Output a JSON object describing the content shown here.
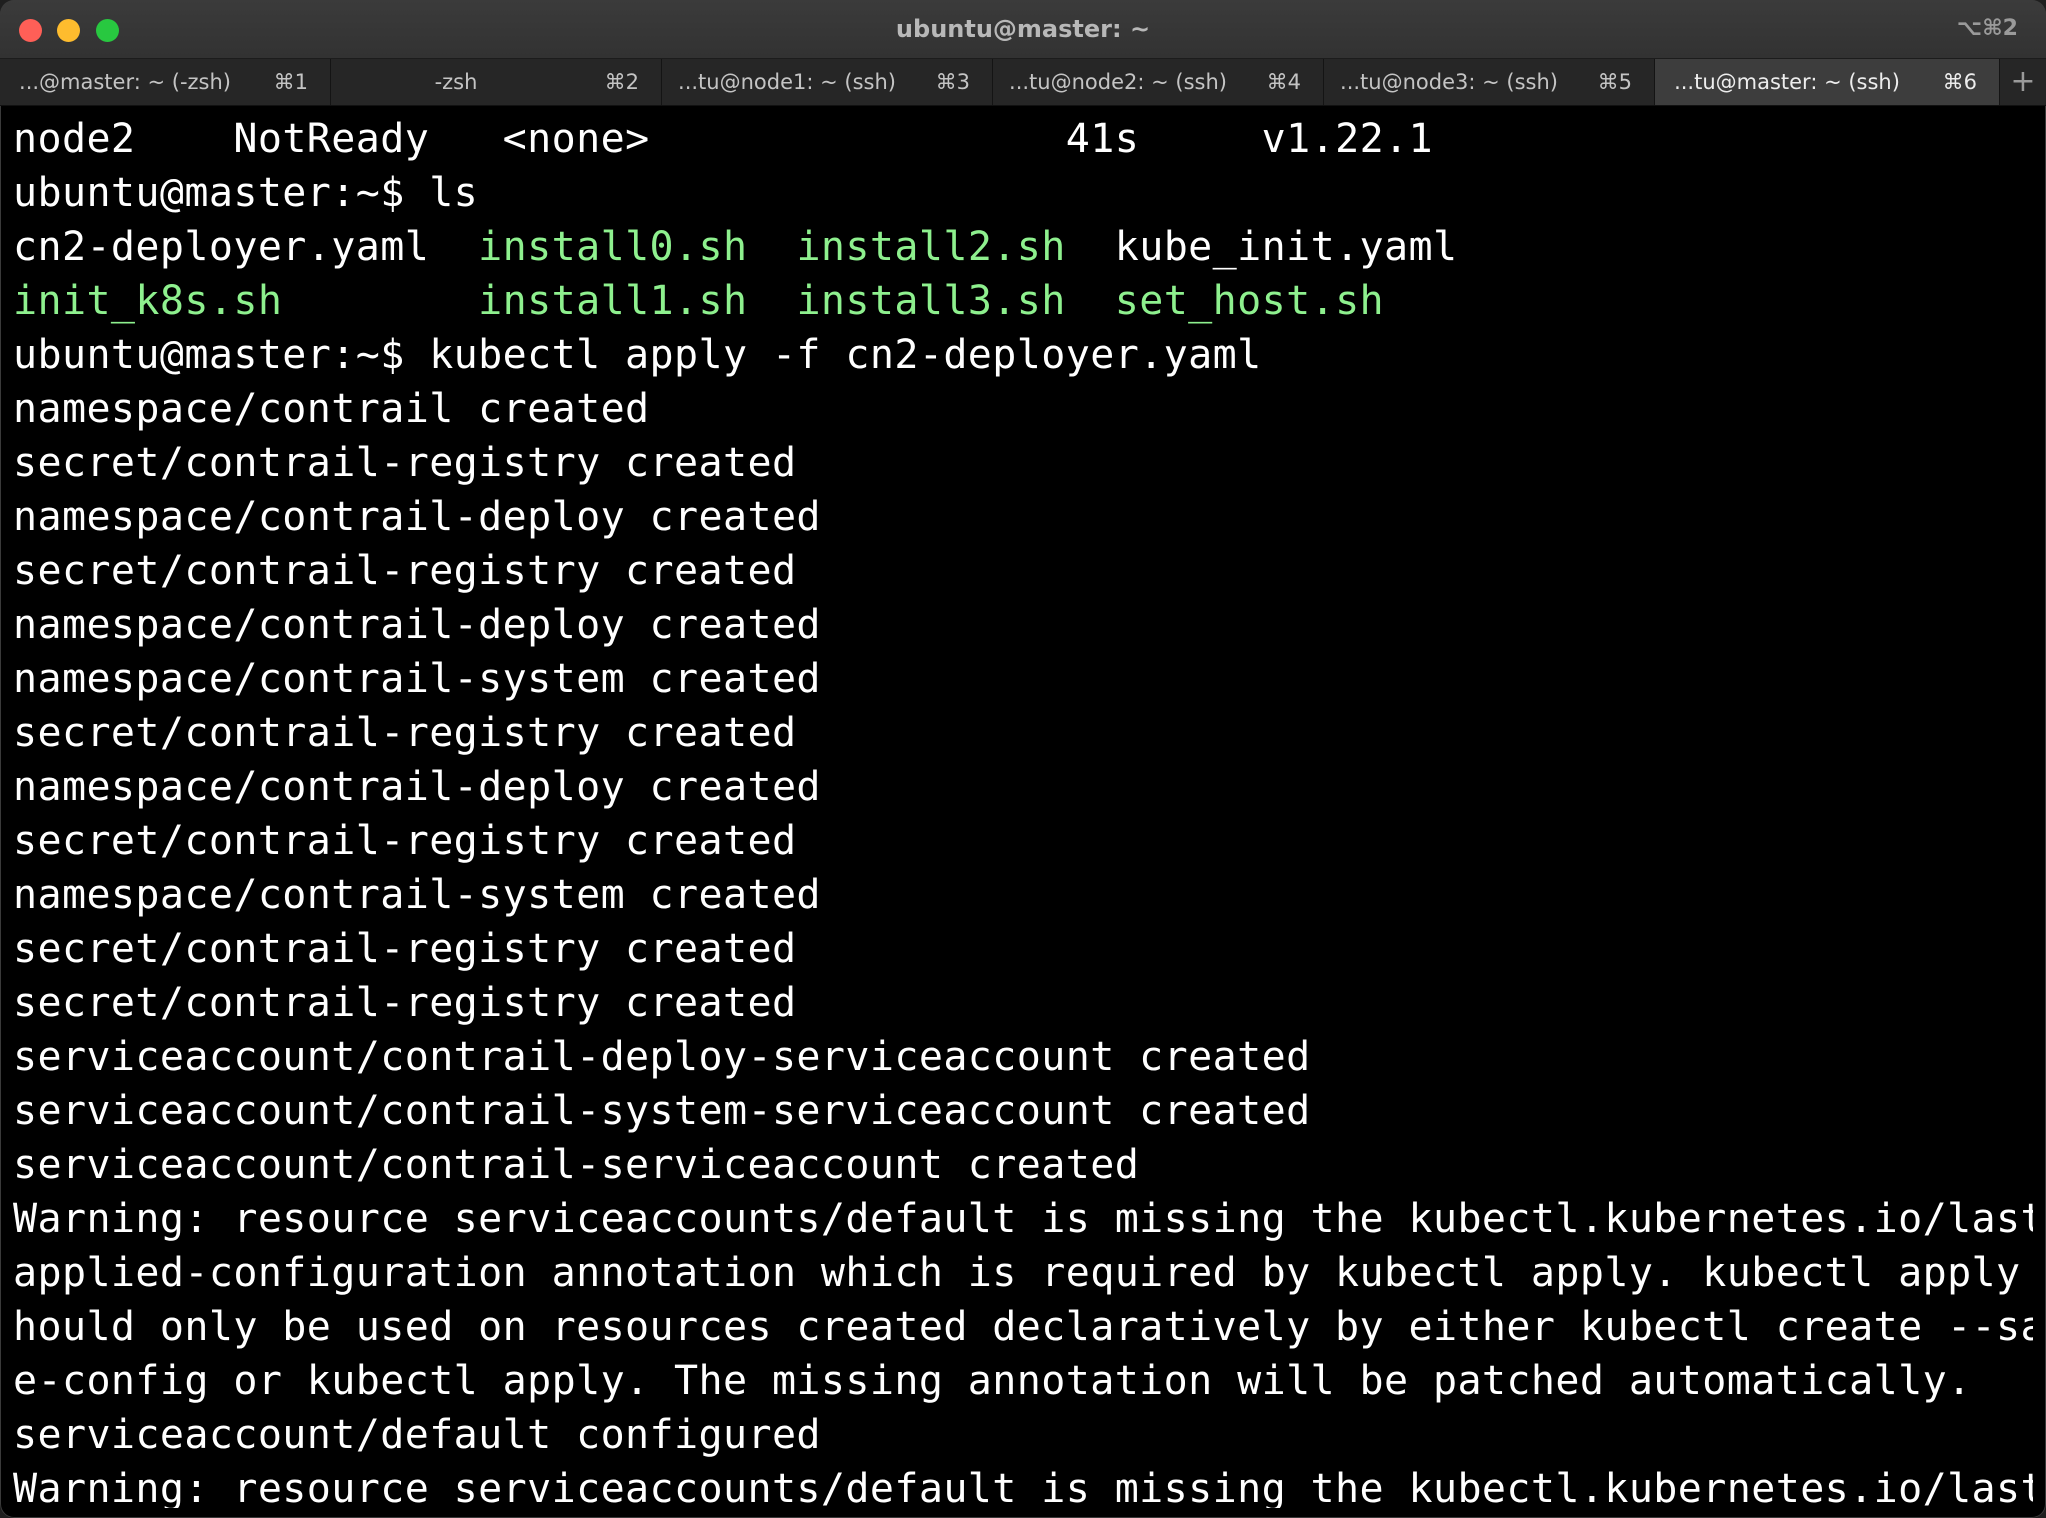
{
  "window": {
    "title": "ubuntu@master: ~",
    "shortcut": "⌥⌘2",
    "new_tab": "+"
  },
  "tabs": [
    {
      "label": "...@master: ~ (-zsh)",
      "key": "⌘1"
    },
    {
      "label": "-zsh",
      "key": "⌘2"
    },
    {
      "label": "...tu@node1: ~ (ssh)",
      "key": "⌘3"
    },
    {
      "label": "...tu@node2: ~ (ssh)",
      "key": "⌘4"
    },
    {
      "label": "...tu@node3: ~ (ssh)",
      "key": "⌘5"
    },
    {
      "label": "...tu@master: ~ (ssh)",
      "key": "⌘6",
      "active": true
    }
  ],
  "terminal": {
    "node_line": {
      "name": "node2",
      "status": "NotReady",
      "roles": "<none>",
      "age": "41s",
      "version": "v1.22.1"
    },
    "ls_prompt": "ubuntu@master:~$ ls",
    "files": {
      "r1c1": "cn2-deployer.yaml",
      "r1c2": "install0.sh",
      "r1c3": "install2.sh",
      "r1c4": "kube_init.yaml",
      "r2c1": "init_k8s.sh",
      "r2c2": "install1.sh",
      "r2c3": "install3.sh",
      "r2c4": "set_host.sh"
    },
    "apply_prompt": "ubuntu@master:~$ kubectl apply -f cn2-deployer.yaml",
    "output": [
      "namespace/contrail created",
      "secret/contrail-registry created",
      "namespace/contrail-deploy created",
      "secret/contrail-registry created",
      "namespace/contrail-deploy created",
      "namespace/contrail-system created",
      "secret/contrail-registry created",
      "namespace/contrail-deploy created",
      "secret/contrail-registry created",
      "namespace/contrail-system created",
      "secret/contrail-registry created",
      "secret/contrail-registry created",
      "serviceaccount/contrail-deploy-serviceaccount created",
      "serviceaccount/contrail-system-serviceaccount created",
      "serviceaccount/contrail-serviceaccount created",
      "Warning: resource serviceaccounts/default is missing the kubectl.kubernetes.io/last-",
      "applied-configuration annotation which is required by kubectl apply. kubectl apply s",
      "hould only be used on resources created declaratively by either kubectl create --sav",
      "e-config or kubectl apply. The missing annotation will be patched automatically.",
      "serviceaccount/default configured",
      "Warning: resource serviceaccounts/default is missing the kubectl.kubernetes.io/last-"
    ]
  },
  "colors": {
    "background": "#000000",
    "foreground": "#ffffff",
    "executable": "#8ef08e",
    "close": "#ff5f57",
    "minimize": "#febc2e",
    "maximize": "#28c840"
  }
}
